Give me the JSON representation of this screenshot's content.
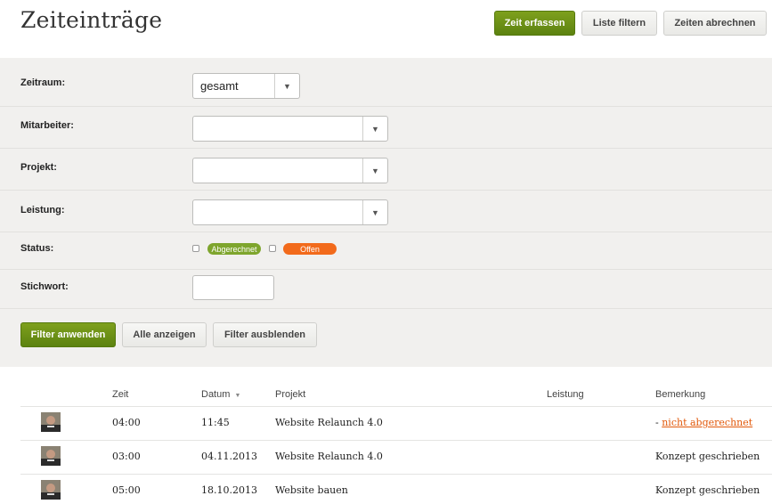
{
  "header": {
    "title": "Zeiteinträge",
    "buttons": {
      "track": "Zeit erfassen",
      "filter": "Liste filtern",
      "bill": "Zeiten abrechnen"
    }
  },
  "filter": {
    "labels": {
      "period": "Zeitraum:",
      "employee": "Mitarbeiter:",
      "project": "Projekt:",
      "service": "Leistung:",
      "status": "Status:",
      "keyword": "Stichwort:"
    },
    "period_value": "gesamt",
    "status_options": [
      "Abgerechnet",
      "Offen"
    ],
    "actions": {
      "apply": "Filter anwenden",
      "show_all": "Alle anzeigen",
      "hide": "Filter ausblenden"
    }
  },
  "table": {
    "columns": {
      "time": "Zeit",
      "date": "Datum",
      "project": "Projekt",
      "service": "Leistung",
      "note": "Bemerkung"
    },
    "rows": [
      {
        "time": "04:00",
        "date": "11:45",
        "project": "Website Relaunch 4.0",
        "service": "",
        "note_prefix": "- ",
        "note": "nicht abgerechnet"
      },
      {
        "time": "03:00",
        "date": "04.11.2013",
        "project": "Website Relaunch 4.0",
        "service": "",
        "note_prefix": "",
        "note": "Konzept geschrieben"
      },
      {
        "time": "05:00",
        "date": "18.10.2013",
        "project": "Website bauen",
        "service": "",
        "note_prefix": "",
        "note": "Konzept geschrieben"
      }
    ]
  },
  "colors": {
    "primary_green": "#6b9117",
    "open_orange": "#f26a1b",
    "billed_green": "#7ea52d",
    "link_orange": "#e2590b",
    "panel_bg": "#f1f0ee"
  },
  "icons": [
    "chevron-down-icon",
    "sort-down-icon",
    "avatar"
  ]
}
